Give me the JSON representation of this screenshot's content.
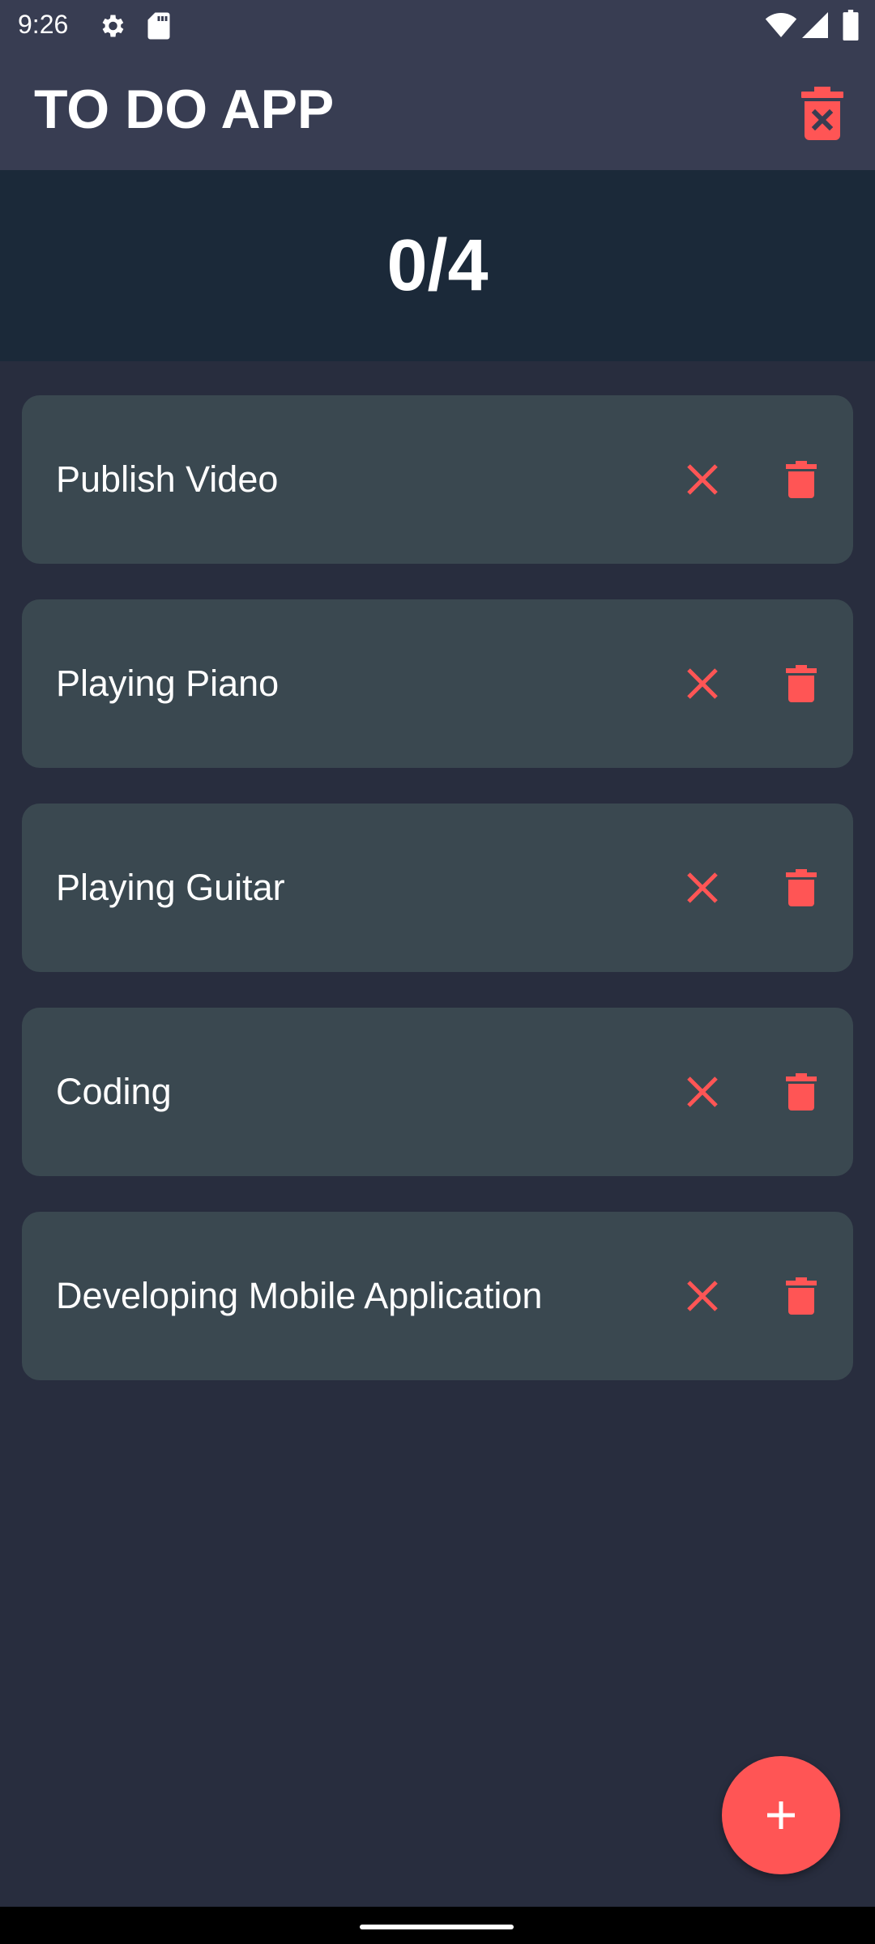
{
  "status_bar": {
    "time": "9:26",
    "icons": [
      "gear-icon",
      "sd-card-icon",
      "wifi-icon",
      "signal-icon",
      "battery-icon"
    ]
  },
  "app_bar": {
    "title": "TO DO APP",
    "clear_all_icon": "trash-x-icon"
  },
  "counter": {
    "text": "0/4"
  },
  "tasks": [
    {
      "label": "Publish Video"
    },
    {
      "label": "Playing Piano"
    },
    {
      "label": "Playing Guitar"
    },
    {
      "label": "Coding"
    },
    {
      "label": "Developing Mobile Application"
    }
  ],
  "fab": {
    "icon": "plus-icon"
  },
  "colors": {
    "background": "#282d3e",
    "app_bar": "#383d52",
    "counter_panel": "#1b2939",
    "card": "#3a4850",
    "accent": "#ff5555",
    "text": "#ffffff"
  }
}
